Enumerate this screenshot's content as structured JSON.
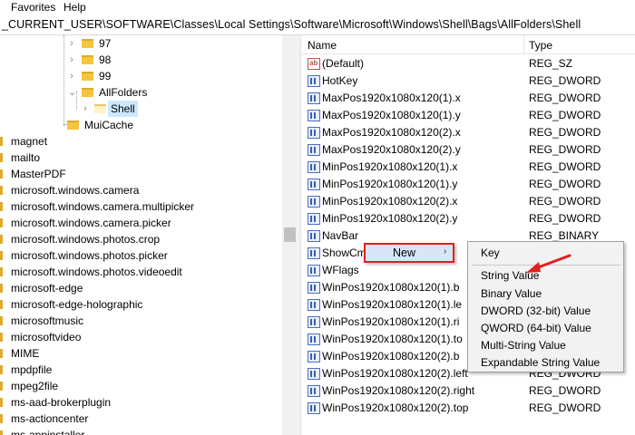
{
  "menubar": {
    "items": [
      "Favorites",
      "Help"
    ]
  },
  "address": {
    "path": "_CURRENT_USER\\SOFTWARE\\Classes\\Local Settings\\Software\\Microsoft\\Windows\\Shell\\Bags\\AllFolders\\Shell"
  },
  "tree": {
    "nodes": [
      {
        "label": "97"
      },
      {
        "label": "98"
      },
      {
        "label": "99"
      },
      {
        "label": "AllFolders"
      },
      {
        "label": "Shell"
      },
      {
        "label": "MuiCache"
      },
      {
        "label": "magnet"
      },
      {
        "label": "mailto"
      },
      {
        "label": "MasterPDF"
      },
      {
        "label": "microsoft.windows.camera"
      },
      {
        "label": "microsoft.windows.camera.multipicker"
      },
      {
        "label": "microsoft.windows.camera.picker"
      },
      {
        "label": "microsoft.windows.photos.crop"
      },
      {
        "label": "microsoft.windows.photos.picker"
      },
      {
        "label": "microsoft.windows.photos.videoedit"
      },
      {
        "label": "microsoft-edge"
      },
      {
        "label": "microsoft-edge-holographic"
      },
      {
        "label": "microsoftmusic"
      },
      {
        "label": "microsoftvideo"
      },
      {
        "label": "MIME"
      },
      {
        "label": "mpdpfile"
      },
      {
        "label": "mpeg2file"
      },
      {
        "label": "ms-aad-brokerplugin"
      },
      {
        "label": "ms-actioncenter"
      },
      {
        "label": "ms-appinstaller"
      }
    ]
  },
  "list": {
    "header": {
      "name": "Name",
      "type": "Type"
    },
    "rows": [
      {
        "name": "(Default)",
        "type": "REG_SZ",
        "icon": "string-value-icon"
      },
      {
        "name": "HotKey",
        "type": "REG_DWORD",
        "icon": "binary-value-icon"
      },
      {
        "name": "MaxPos1920x1080x120(1).x",
        "type": "REG_DWORD",
        "icon": "binary-value-icon"
      },
      {
        "name": "MaxPos1920x1080x120(1).y",
        "type": "REG_DWORD",
        "icon": "binary-value-icon"
      },
      {
        "name": "MaxPos1920x1080x120(2).x",
        "type": "REG_DWORD",
        "icon": "binary-value-icon"
      },
      {
        "name": "MaxPos1920x1080x120(2).y",
        "type": "REG_DWORD",
        "icon": "binary-value-icon"
      },
      {
        "name": "MinPos1920x1080x120(1).x",
        "type": "REG_DWORD",
        "icon": "binary-value-icon"
      },
      {
        "name": "MinPos1920x1080x120(1).y",
        "type": "REG_DWORD",
        "icon": "binary-value-icon"
      },
      {
        "name": "MinPos1920x1080x120(2).x",
        "type": "REG_DWORD",
        "icon": "binary-value-icon"
      },
      {
        "name": "MinPos1920x1080x120(2).y",
        "type": "REG_DWORD",
        "icon": "binary-value-icon"
      },
      {
        "name": "NavBar",
        "type": "REG_BINARY",
        "icon": "binary-value-icon"
      },
      {
        "name": "ShowCm",
        "type": "",
        "icon": "binary-value-icon"
      },
      {
        "name": "WFlags",
        "type": "",
        "icon": "binary-value-icon"
      },
      {
        "name": "WinPos1920x1080x120(1).b",
        "type": "",
        "icon": "binary-value-icon"
      },
      {
        "name": "WinPos1920x1080x120(1).le",
        "type": "",
        "icon": "binary-value-icon"
      },
      {
        "name": "WinPos1920x1080x120(1).ri",
        "type": "",
        "icon": "binary-value-icon"
      },
      {
        "name": "WinPos1920x1080x120(1).to",
        "type": "",
        "icon": "binary-value-icon"
      },
      {
        "name": "WinPos1920x1080x120(2).b",
        "type": "",
        "icon": "binary-value-icon"
      },
      {
        "name": "WinPos1920x1080x120(2).left",
        "type": "REG_DWORD",
        "icon": "binary-value-icon"
      },
      {
        "name": "WinPos1920x1080x120(2).right",
        "type": "REG_DWORD",
        "icon": "binary-value-icon"
      },
      {
        "name": "WinPos1920x1080x120(2).top",
        "type": "REG_DWORD",
        "icon": "binary-value-icon"
      }
    ]
  },
  "context_menu": {
    "new_label": "New",
    "new_arrow": "›",
    "submenu": [
      "Key",
      "String Value",
      "Binary Value",
      "DWORD (32-bit) Value",
      "QWORD (64-bit) Value",
      "Multi-String Value",
      "Expandable String Value"
    ]
  },
  "colors": {
    "highlight_border": "#e02020",
    "arrow": "#e02020",
    "selection": "#cce8ff"
  }
}
